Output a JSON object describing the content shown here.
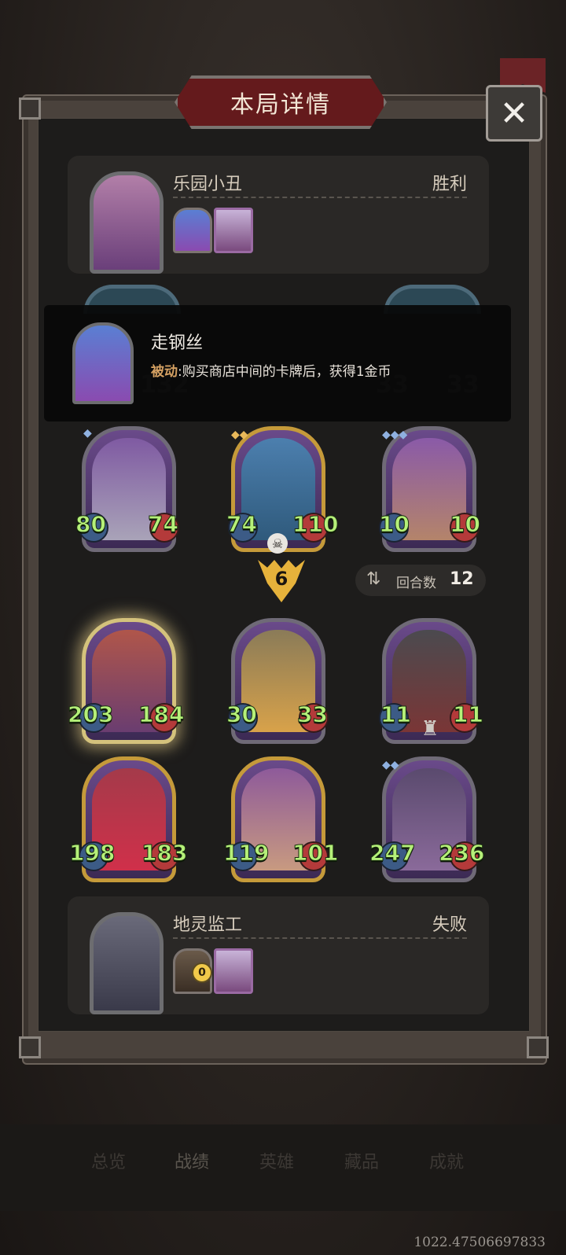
{
  "title": "本局详情",
  "winner": {
    "name": "乐园小丑",
    "result": "胜利"
  },
  "loser": {
    "name": "地灵监工",
    "result": "失败",
    "coin_count": "0"
  },
  "tooltip": {
    "title": "走钢丝",
    "desc_prefix": "被动",
    "desc_body": ":购买商店中间的卡牌后，获得1金币"
  },
  "hidden_row": {
    "left_value": "132",
    "right_atk": "33",
    "right_hp": "33"
  },
  "enemy_units": [
    {
      "atk": "80",
      "hp": "74",
      "stars": "◆"
    },
    {
      "atk": "74",
      "hp": "110",
      "stars": "◆◆"
    },
    {
      "atk": "10",
      "hp": "10",
      "stars": "◆◆◆"
    }
  ],
  "tier": "6",
  "round": {
    "label": "回合数",
    "value": "12"
  },
  "player_units_row1": [
    {
      "atk": "203",
      "hp": "184"
    },
    {
      "atk": "30",
      "hp": "33"
    },
    {
      "atk": "11",
      "hp": "11"
    }
  ],
  "player_units_row2": [
    {
      "atk": "198",
      "hp": "183"
    },
    {
      "atk": "119",
      "hp": "101"
    },
    {
      "atk": "247",
      "hp": "236",
      "stars": "◆◆"
    }
  ],
  "nav": [
    "总览",
    "战绩",
    "英雄",
    "藏品",
    "成就"
  ],
  "debug_coords": "1022.47506697833",
  "colors": {
    "stat_green": "#b5f079",
    "title_red": "#641a1c",
    "gold": "#e6b23b"
  }
}
